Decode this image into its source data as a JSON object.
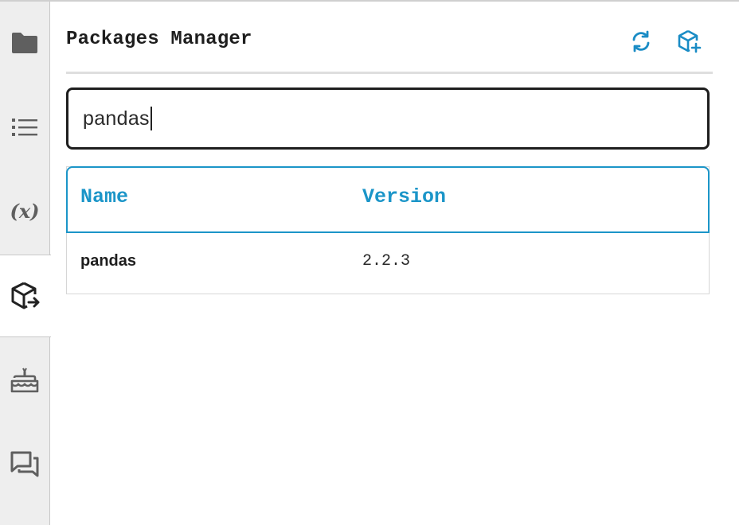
{
  "activity_bar": {
    "items": [
      {
        "icon": "folder-icon",
        "active": false
      },
      {
        "icon": "list-icon",
        "active": false
      },
      {
        "icon": "variable-icon",
        "label": "(x)",
        "active": false
      },
      {
        "icon": "package-export-icon",
        "active": true
      },
      {
        "icon": "cake-icon",
        "active": false
      },
      {
        "icon": "chat-icon",
        "active": false
      }
    ]
  },
  "panel": {
    "title": "Packages Manager",
    "toolbar": {
      "refresh_icon": "refresh-icon",
      "add_package_icon": "package-add-icon"
    },
    "search": {
      "value": "pandas"
    },
    "table": {
      "columns": [
        "Name",
        "Version"
      ],
      "rows": [
        {
          "name": "pandas",
          "version": "2.2.3"
        }
      ]
    }
  },
  "colors": {
    "accent": "#1b95c8",
    "sidebar_bg": "#eeeeee",
    "text": "#1e1e1e"
  }
}
